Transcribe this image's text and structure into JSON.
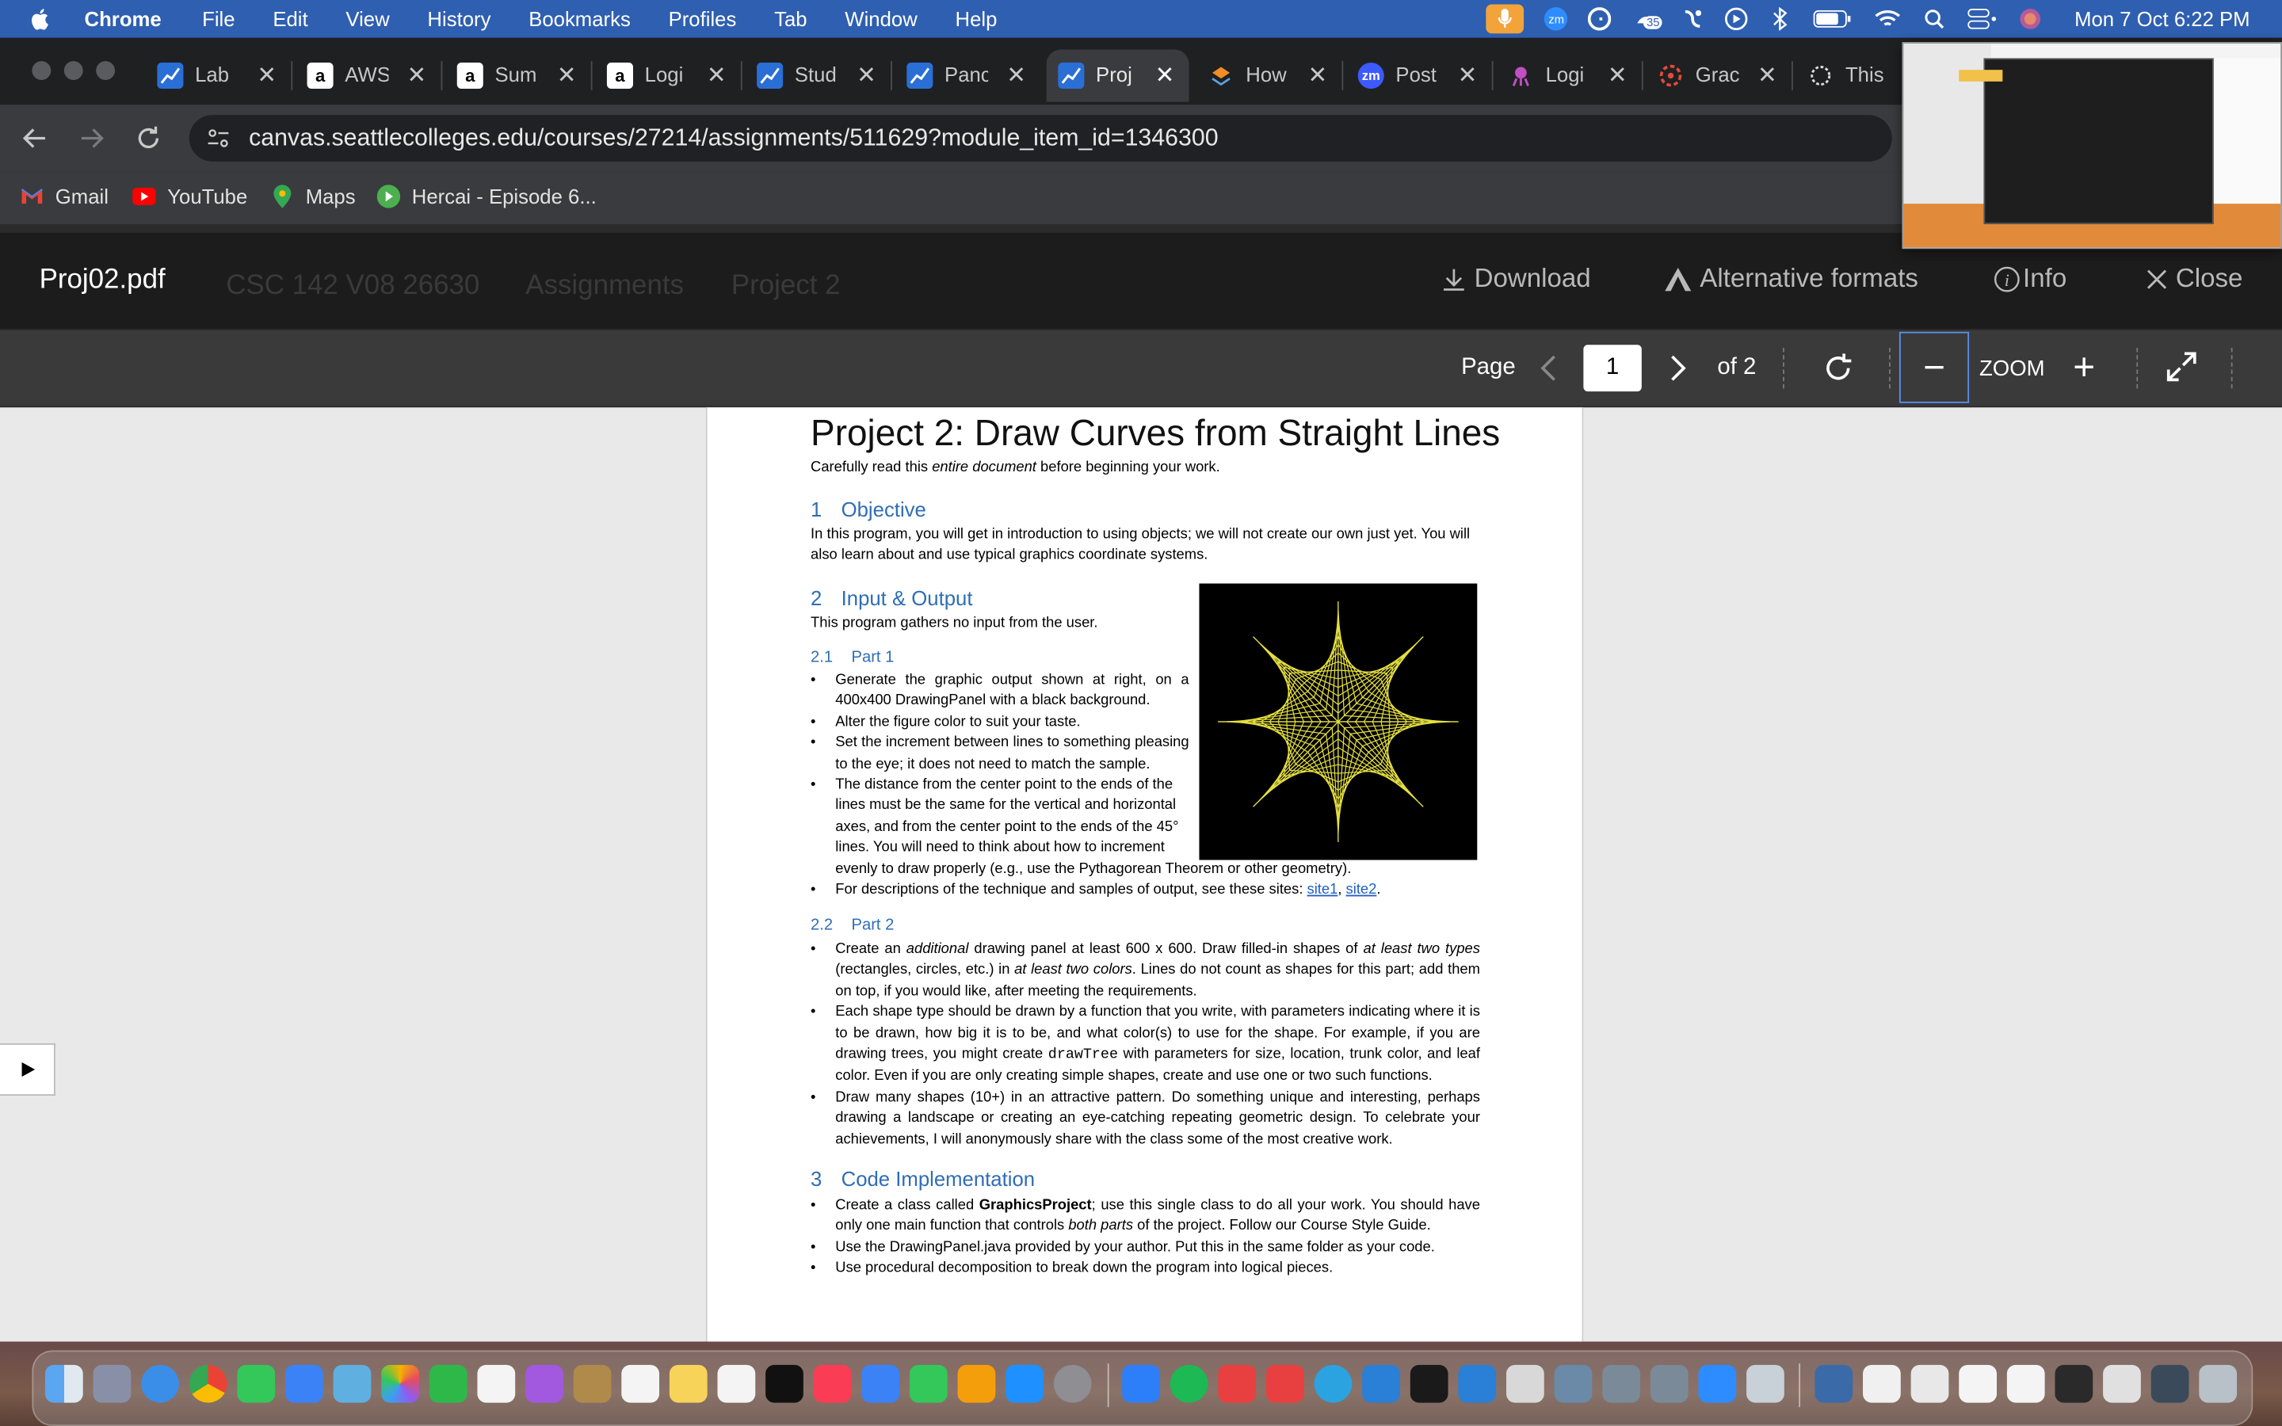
{
  "menubar": {
    "items": [
      "Chrome",
      "File",
      "Edit",
      "View",
      "History",
      "Bookmarks",
      "Profiles",
      "Tab",
      "Window",
      "Help"
    ],
    "notification_badge": "35",
    "clock": "Mon 7 Oct  6:22 PM",
    "icons": [
      "apple-icon",
      "microphone-icon",
      "zoom-icon",
      "grammarly-icon",
      "notification-icon",
      "accessibility-icon",
      "play-icon",
      "bluetooth-icon",
      "battery-icon",
      "wifi-icon",
      "search-icon",
      "control-center-icon",
      "siri-icon"
    ]
  },
  "tabs": [
    {
      "title": "Lab",
      "favicon": "canvas"
    },
    {
      "title": "AWS",
      "favicon": "amazon"
    },
    {
      "title": "Sum",
      "favicon": "amazon"
    },
    {
      "title": "Logi",
      "favicon": "amazon"
    },
    {
      "title": "Stud",
      "favicon": "canvas"
    },
    {
      "title": "Panc",
      "favicon": "canvas"
    },
    {
      "title": "Proj",
      "favicon": "canvas",
      "active": true
    },
    {
      "title": "How",
      "favicon": "stack"
    },
    {
      "title": "Post",
      "favicon": "zoom"
    },
    {
      "title": "Logi",
      "favicon": "github"
    },
    {
      "title": "Grac",
      "favicon": "gradescope"
    },
    {
      "title": "This",
      "favicon": "openai"
    }
  ],
  "address": {
    "url": "canvas.seattlecolleges.edu/courses/27214/assignments/511629?module_item_id=1346300"
  },
  "bookmarks": [
    {
      "label": "Gmail",
      "icon": "gmail-icon"
    },
    {
      "label": "YouTube",
      "icon": "youtube-icon"
    },
    {
      "label": "Maps",
      "icon": "maps-icon"
    },
    {
      "label": "Hercai - Episode 6...",
      "icon": "play-icon"
    }
  ],
  "file_header": {
    "filename": "Proj02.pdf",
    "background_crumbs": [
      "CSC 142 V08 26630",
      "Assignments",
      "Project 2"
    ],
    "download": "Download",
    "alt_formats": "Alternative formats",
    "info": "Info",
    "close": "Close"
  },
  "pdf_toolbar": {
    "page_label": "Page",
    "page_value": "1",
    "of_label": "of 2",
    "zoom_label": "ZOOM"
  },
  "document": {
    "title": "Project 2:  Draw Curves from Straight Lines",
    "subtitle_a": "Carefully read this ",
    "subtitle_em": "entire document",
    "subtitle_b": " before beginning your work.",
    "s1_num": "1",
    "s1_title": "Objective",
    "s1_text": "In this program, you will get in introduction to using objects; we will not create our own just yet.  You will also learn about and use typical graphics coordinate systems.",
    "s2_num": "2",
    "s2_title": "Input & Output",
    "s2_text": "This program gathers no input from the user.",
    "s21_num": "2.1",
    "s21_title": "Part 1",
    "p1_b1": "Generate the graphic output shown at right, on a 400x400 DrawingPanel with a black background.",
    "p1_b2": "Alter the figure color to suit your taste.",
    "p1_b3": "Set the increment between lines to something pleasing to the eye; it does not need to match the sample.",
    "p1_b4_l1": "The distance from the center point to the ends of the",
    "p1_b4_l2": "lines must be the same for the vertical and horizontal",
    "p1_b4_l3": "axes, and from the center point to the ends of the 45°",
    "p1_b4_l4": "lines.  You will need to think about how to increment",
    "p1_b4_l5": "evenly to draw properly (e.g., use the Pythagorean Theorem or other geometry).",
    "p1_b5": "For descriptions of the technique and samples of output, see these sites:  ",
    "link1": "site1",
    "link_sep": ", ",
    "link2": "site2",
    "link_end": ".",
    "s22_num": "2.2",
    "s22_title": "Part 2",
    "p2_b1_a": "Create an ",
    "p2_b1_em1": "additional",
    "p2_b1_b": " drawing panel at least 600 x 600.  Draw filled-in shapes of ",
    "p2_b1_em2": "at least two types",
    "p2_b1_c": " (rectangles, circles, etc.) in ",
    "p2_b1_em3": "at least two colors",
    "p2_b1_d": ".  Lines do not count as shapes for this part; add them on top, if you would like, after meeting the requirements.",
    "p2_b2_a": "Each shape type should be drawn by a function that you write, with parameters indicating where it is to be drawn, how big it is to be, and what color(s) to use for the shape.  For example, if you are drawing trees, you might create ",
    "p2_b2_code": "drawTree",
    "p2_b2_b": " with parameters for size, location, trunk color, and leaf color.  Even if you are only creating simple shapes, create and use one or two such functions.",
    "p2_b3": "Draw many shapes (10+) in an attractive pattern.  Do something unique and interesting, perhaps drawing a landscape or creating an eye-catching repeating geometric design.  To celebrate your achievements, I will anonymously share with the class some of the most creative work.",
    "s3_num": "3",
    "s3_title": "Code Implementation",
    "p3_b1_a": "Create a class called ",
    "p3_b1_strong": "GraphicsProject",
    "p3_b1_b": "; use this single class to do all your work.  You should have only one main function that controls ",
    "p3_b1_em": "both parts",
    "p3_b1_c": " of the project.  Follow our Course Style Guide.",
    "p3_b2": "Use the DrawingPanel.java provided by your author.  Put this in the same folder as your code.",
    "p3_b3": "Use procedural decomposition to break down the program into logical pieces."
  },
  "colors": {
    "menubar": "#2f5fb0",
    "accent_link": "#2f6db5",
    "star_line": "#e6e040",
    "star_bg": "#000000"
  }
}
